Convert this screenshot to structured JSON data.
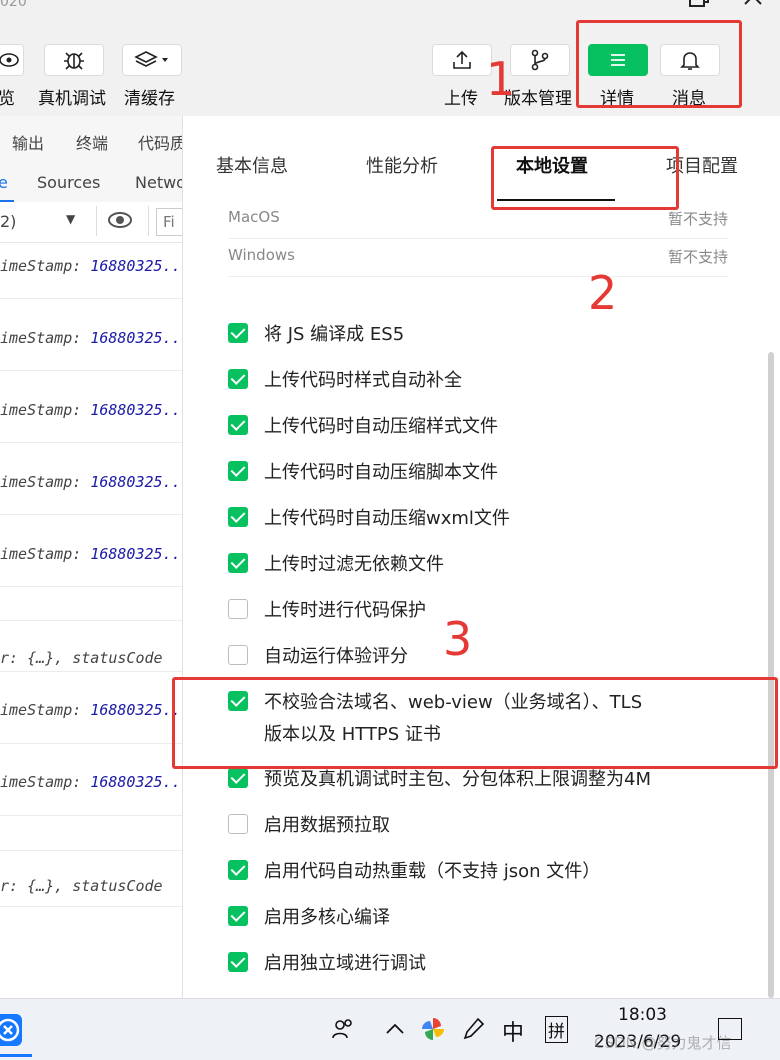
{
  "window": {
    "title_fragment": "020"
  },
  "toolbar": {
    "left_partial_label": "览",
    "remote_debug_label": "真机调试",
    "clear_cache_label": "清缓存",
    "upload_label": "上传",
    "version_label": "版本管理",
    "details_label": "详情",
    "messages_label": "消息"
  },
  "devtools": {
    "tabs_row1": [
      "输出",
      "终端",
      "代码质"
    ],
    "tabs_row2": [
      "e",
      "Sources",
      "Netwo"
    ],
    "filter_level": "2)",
    "filter_placeholder": "Fi",
    "log_lines": [
      {
        "kind": "stamp",
        "prefix": "imeStamp: ",
        "value": "16880325..."
      },
      {
        "kind": "stamp",
        "prefix": "imeStamp: ",
        "value": "16880325..."
      },
      {
        "kind": "stamp",
        "prefix": "imeStamp: ",
        "value": "16880325..."
      },
      {
        "kind": "stamp",
        "prefix": "imeStamp: ",
        "value": "16880325..."
      },
      {
        "kind": "stamp",
        "prefix": "imeStamp: ",
        "value": "16880325..."
      },
      {
        "kind": "status",
        "prefix": "r: {…}, statusCode",
        "value": ""
      },
      {
        "kind": "stamp",
        "prefix": "imeStamp: ",
        "value": "16880325..."
      },
      {
        "kind": "stamp",
        "prefix": "imeStamp: ",
        "value": "16880325..."
      },
      {
        "kind": "status",
        "prefix": "r: {…}, statusCode",
        "value": ""
      }
    ]
  },
  "panel": {
    "tabs": [
      "基本信息",
      "性能分析",
      "本地设置",
      "项目配置"
    ],
    "active_tab": "本地设置",
    "platforms": [
      {
        "name": "MacOS",
        "value": "暂不支持"
      },
      {
        "name": "Windows",
        "value": "暂不支持"
      }
    ],
    "options": [
      {
        "label": "将 JS 编译成 ES5",
        "checked": true
      },
      {
        "label": "上传代码时样式自动补全",
        "checked": true
      },
      {
        "label": "上传代码时自动压缩样式文件",
        "checked": true
      },
      {
        "label": "上传代码时自动压缩脚本文件",
        "checked": true
      },
      {
        "label": "上传代码时自动压缩wxml文件",
        "checked": true
      },
      {
        "label": "上传时过滤无依赖文件",
        "checked": true
      },
      {
        "label": "上传时进行代码保护",
        "checked": false
      },
      {
        "label": "自动运行体验评分",
        "checked": false
      },
      {
        "label": "不校验合法域名、web-view（业务域名）、TLS",
        "label2": "版本以及 HTTPS 证书",
        "checked": true
      },
      {
        "label": "预览及真机调试时主包、分包体积上限调整为4M",
        "checked": true
      },
      {
        "label": "启用数据预拉取",
        "checked": false
      },
      {
        "label": "启用代码自动热重载（不支持 json 文件）",
        "checked": true
      },
      {
        "label": "启用多核心编译",
        "checked": true
      },
      {
        "label": "启用独立域进行调试",
        "checked": true
      }
    ]
  },
  "annotations": {
    "n1": "1",
    "n2": "2",
    "n3": "3",
    "color": "#e53935"
  },
  "taskbar": {
    "time": "18:03",
    "date": "2023/6/29",
    "ime": "中",
    "ime2": "拼",
    "watermark": "CSDN @努力鬼才信"
  },
  "colors": {
    "accent": "#07c160",
    "link_number": "#1a1aa6"
  }
}
